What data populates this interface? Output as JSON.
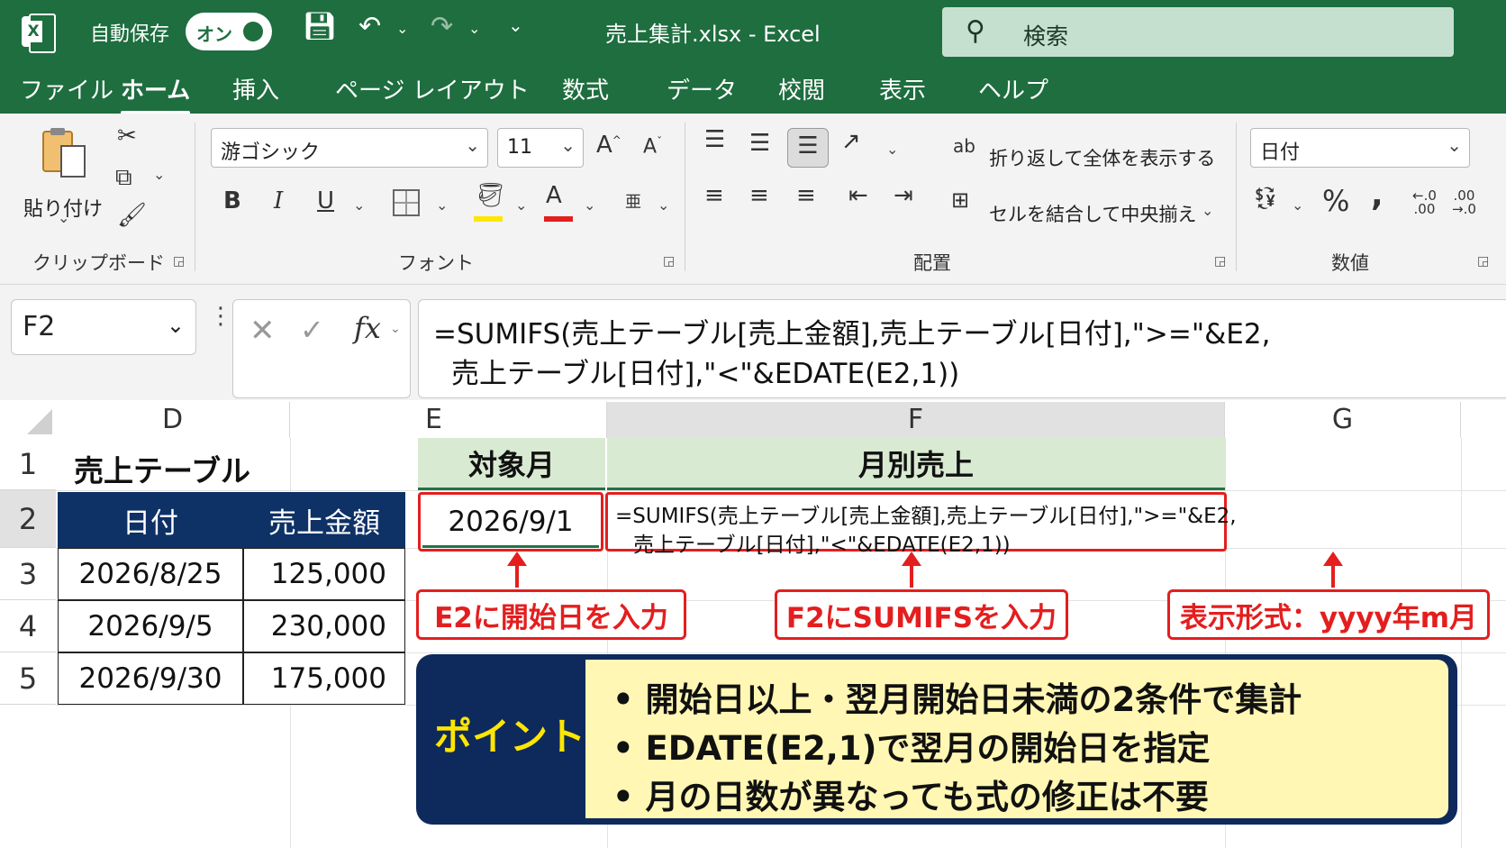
{
  "titlebar": {
    "app_icon": "excel-logo",
    "autosave_label": "自動保存",
    "autosave_state": "オン",
    "doc_title": "売上集計.xlsx  -  Excel",
    "search_placeholder": "検索"
  },
  "menu": {
    "tabs": [
      "ファイル",
      "ホーム",
      "挿入",
      "ページ レイアウト",
      "数式",
      "データ",
      "校閲",
      "表示",
      "ヘルプ"
    ],
    "active": "ホーム"
  },
  "ribbon": {
    "clipboard": {
      "paste_label": "貼り付け",
      "group_label": "クリップボード"
    },
    "font": {
      "font_name": "游ゴシック",
      "font_size": "11",
      "bold": "B",
      "italic": "I",
      "underline": "U",
      "font_color_letter": "A",
      "grow": "A",
      "shrink": "A",
      "group_label": "フォント"
    },
    "alignment": {
      "wrap_text": "折り返して全体を表示する",
      "merge_center": "セルを結合して中央揃え",
      "group_label": "配置"
    },
    "number": {
      "format": "日付",
      "percent": "%",
      "comma": ",",
      "group_label": "数値"
    }
  },
  "formula_bar": {
    "name_box": "F2",
    "fx": "fx",
    "formula_line1": "=SUMIFS(売上テーブル[売上金額],売上テーブル[日付],\">=\"&E2,",
    "formula_line2": "売上テーブル[日付],\"<\"&EDATE(E2,1))"
  },
  "grid": {
    "columns": [
      "D",
      "E",
      "F",
      "G"
    ],
    "rows": [
      "1",
      "2",
      "3",
      "4",
      "5"
    ],
    "table_title": "売上テーブル",
    "table_headers": [
      "日付",
      "売上金額"
    ],
    "table_rows": [
      {
        "date": "2026/8/25",
        "amount": "125,000"
      },
      {
        "date": "2026/9/5",
        "amount": "230,000"
      },
      {
        "date": "2026/9/30",
        "amount": "175,000"
      }
    ],
    "e1_header": "対象月",
    "f1_header": "月別売上",
    "e2_value": "2026/9/1",
    "f2_line1": "=SUMIFS(売上テーブル[売上金額],売上テーブル[日付],\">=\"&E2,",
    "f2_line2": "売上テーブル[日付],\"<\"&EDATE(E2,1))"
  },
  "callouts": {
    "e2": "E2に開始日を入力",
    "f2": "F2にSUMIFSを入力",
    "g": "表示形式：yyyy年m月"
  },
  "point_box": {
    "title": "ポイント",
    "bullets": [
      "• 開始日以上・翌月開始日未満の2条件で集計",
      "• EDATE(E2,1)で翌月の開始日を指定",
      "• 月の日数が異なっても式の修正は不要"
    ]
  },
  "colors": {
    "excel_green": "#1e6e3f",
    "table_header_navy": "#0e3166",
    "callout_red": "#e41e1e",
    "point_yellow": "#fff7b3",
    "point_title_yellow": "#ffe600"
  }
}
